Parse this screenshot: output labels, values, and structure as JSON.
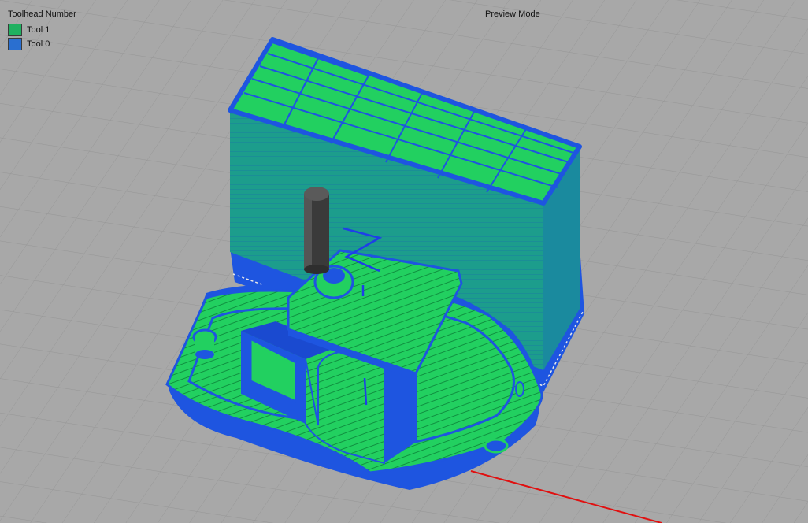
{
  "legend": {
    "title": "Toolhead Number",
    "items": [
      {
        "label": "Tool 1",
        "color": "#20b060"
      },
      {
        "label": "Tool 0",
        "color": "#2a6fd0"
      }
    ]
  },
  "view": {
    "mode_label": "Preview Mode"
  },
  "colors": {
    "background": "#a8a8a8",
    "grid_line": "#9a9a9a",
    "tool0": "#1e55e0",
    "tool1": "#22d060",
    "axis_x": "#e01010",
    "nozzle": "#3a3a3a"
  }
}
